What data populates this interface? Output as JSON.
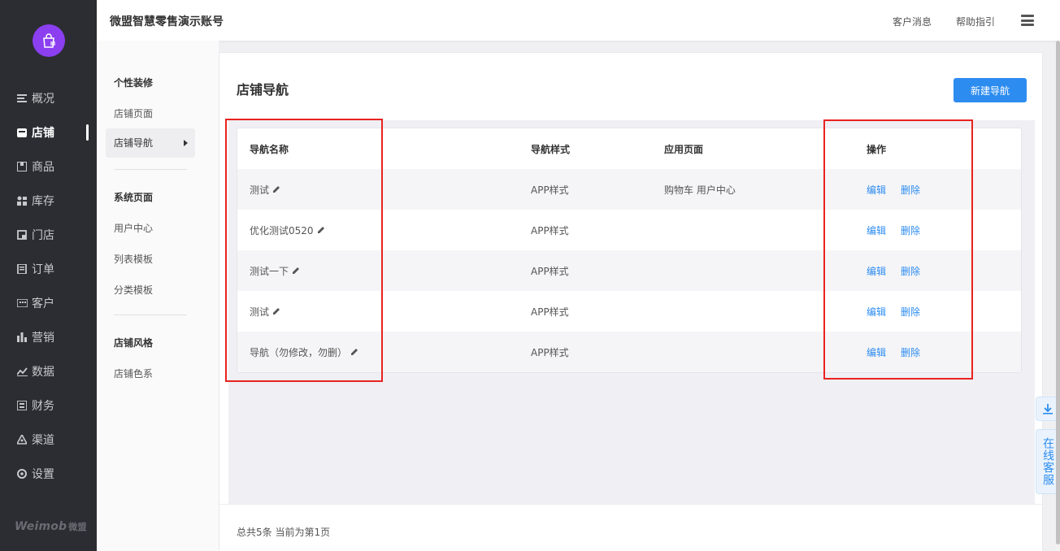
{
  "header": {
    "title": "微盟智慧零售演示账号",
    "links": [
      "客户消息",
      "帮助指引"
    ]
  },
  "leftnav": {
    "items": [
      {
        "label": "概况",
        "icon": "list-icon"
      },
      {
        "label": "店铺",
        "icon": "store-icon",
        "active": true
      },
      {
        "label": "商品",
        "icon": "goods-icon"
      },
      {
        "label": "库存",
        "icon": "inventory-icon"
      },
      {
        "label": "门店",
        "icon": "shop-icon"
      },
      {
        "label": "订单",
        "icon": "order-icon"
      },
      {
        "label": "客户",
        "icon": "customer-icon"
      },
      {
        "label": "营销",
        "icon": "marketing-icon"
      },
      {
        "label": "数据",
        "icon": "data-icon"
      },
      {
        "label": "财务",
        "icon": "finance-icon"
      },
      {
        "label": "渠道",
        "icon": "channel-icon"
      },
      {
        "label": "设置",
        "icon": "settings-icon"
      }
    ],
    "brand": "Weimob",
    "brand_cn": "微盟"
  },
  "subnav": {
    "groups": [
      {
        "title": "个性装修",
        "items": [
          "店铺页面",
          "店铺导航"
        ]
      },
      {
        "title": "系统页面",
        "items": [
          "用户中心",
          "列表模板",
          "分类模板"
        ]
      },
      {
        "title": "店铺风格",
        "items": [
          "店铺色系"
        ]
      }
    ]
  },
  "main": {
    "title": "店铺导航",
    "new_button": "新建导航",
    "columns": [
      "导航名称",
      "导航样式",
      "应用页面",
      "操作"
    ],
    "rows": [
      {
        "name": "测试",
        "style": "APP样式",
        "pages": "购物车 用户中心"
      },
      {
        "name": "优化测试0520",
        "style": "APP样式",
        "pages": ""
      },
      {
        "name": "测试一下",
        "style": "APP样式",
        "pages": ""
      },
      {
        "name": "测试",
        "style": "APP样式",
        "pages": ""
      },
      {
        "name": "导航（勿修改，勿删）",
        "style": "APP样式",
        "pages": ""
      }
    ],
    "actions": {
      "edit": "编辑",
      "delete": "删除"
    },
    "pagination": "总共5条 当前为第1页"
  },
  "float": {
    "service": "在线客服"
  },
  "colors": {
    "primary": "#2d8cf0",
    "nav_bg": "#2b2d33",
    "logo": "#8b3ff0",
    "highlight": "#e8231f"
  }
}
